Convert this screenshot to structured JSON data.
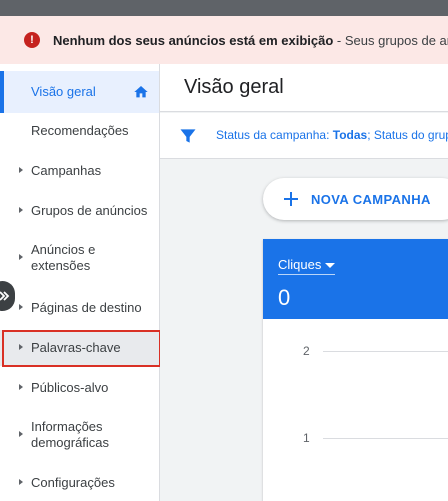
{
  "alert": {
    "bold_text": "Nenhum dos seus anúncios está em exibição",
    "rest_text": " - Seus grupos de anúncios"
  },
  "sidebar": {
    "items": [
      {
        "label": "Visão geral"
      },
      {
        "label": "Recomendações"
      },
      {
        "label": "Campanhas"
      },
      {
        "label": "Grupos de anúncios"
      },
      {
        "label": "Anúncios e extensões"
      },
      {
        "label": "Páginas de destino"
      },
      {
        "label": "Palavras-chave"
      },
      {
        "label": "Públicos-alvo"
      },
      {
        "label": "Informações demográficas"
      },
      {
        "label": "Configurações"
      }
    ]
  },
  "header": {
    "title": "Visão geral"
  },
  "filter": {
    "prefix": "Status da campanha: ",
    "value": "Todas",
    "suffix": "; Status do grupo"
  },
  "actions": {
    "new_campaign": "NOVA CAMPANHA"
  },
  "chart": {
    "metric_name": "Cliques",
    "metric_value": "0",
    "y_ticks": [
      "2",
      "1"
    ]
  },
  "colors": {
    "accent": "#1a73e8",
    "alert_bg": "#fce8e6",
    "alert_icon": "#c5221f",
    "highlight": "#d93025"
  }
}
